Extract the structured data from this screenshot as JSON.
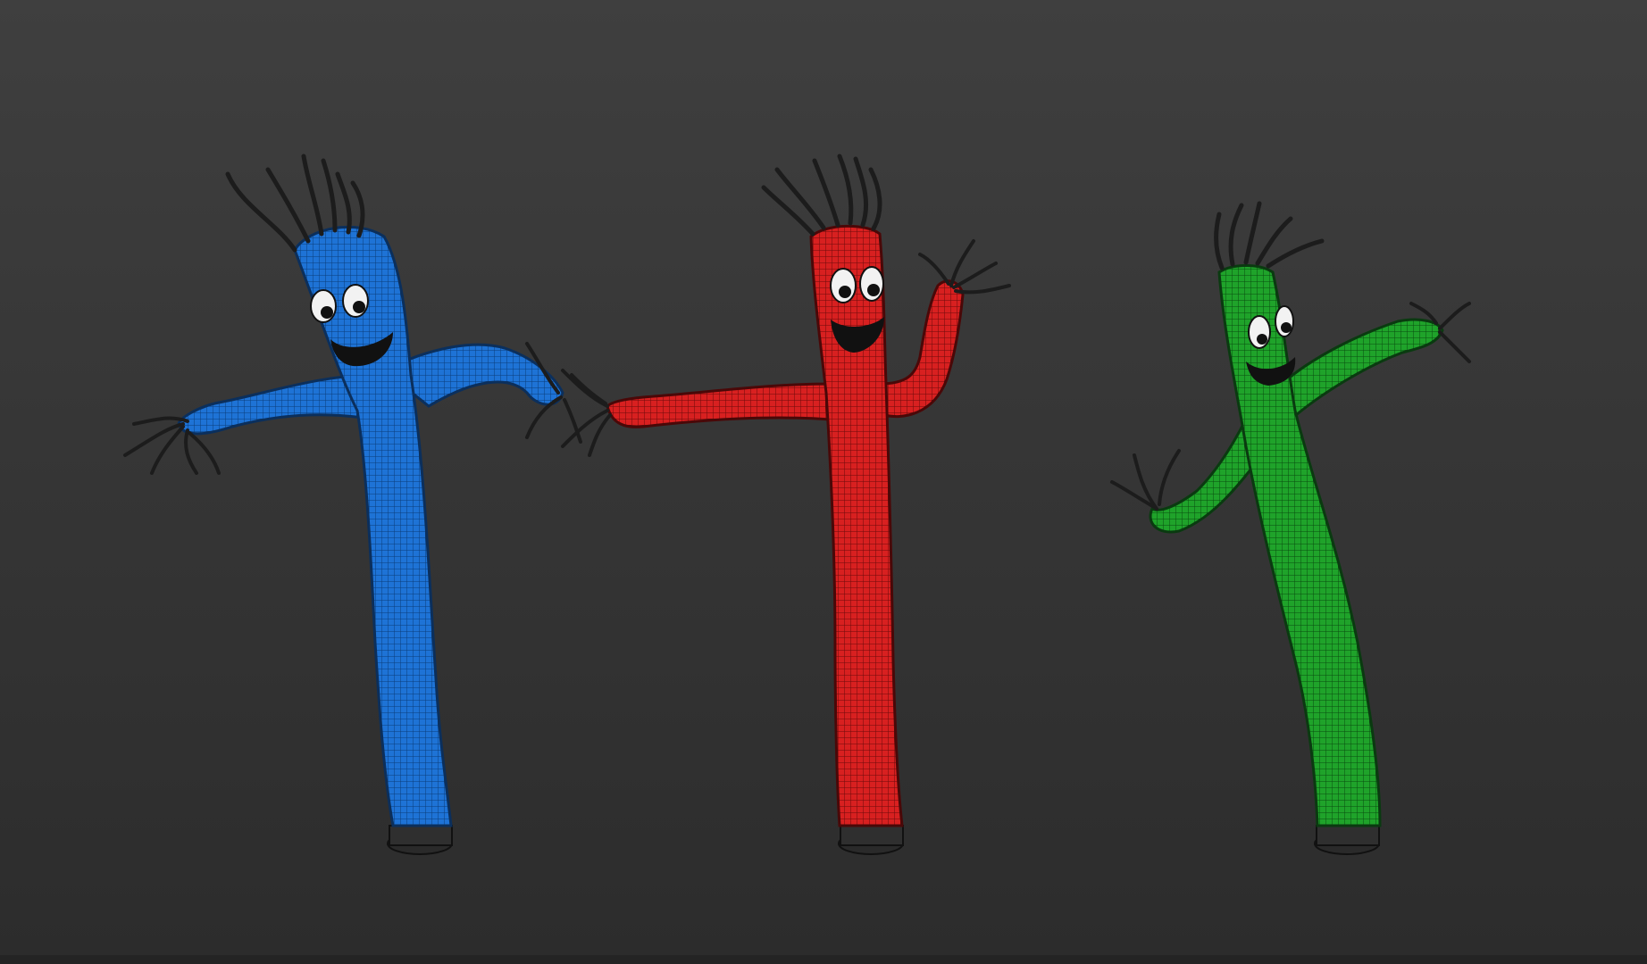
{
  "scene": {
    "background_top": "#3f3f3f",
    "background_bottom": "#2c2c2c",
    "figures": [
      {
        "id": "blue-figure",
        "color": "#1e73d6",
        "mesh_color": "#0b3d7a"
      },
      {
        "id": "red-figure",
        "color": "#d82020",
        "mesh_color": "#6a0a0a"
      },
      {
        "id": "green-figure",
        "color": "#1fa32a",
        "mesh_color": "#0a4d10"
      }
    ],
    "streamer_color": "#1c1c1c",
    "base_color": "#2a2a2a"
  }
}
